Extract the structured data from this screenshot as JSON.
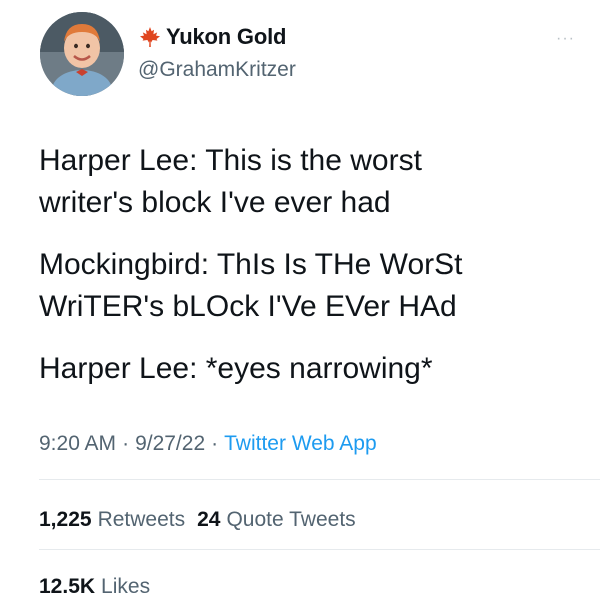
{
  "user": {
    "display_name": "Yukon Gold",
    "handle": "@GrahamKritzer",
    "badge_icon": "maple-leaf-icon",
    "badge_color": "#e0461f"
  },
  "more_icon": "···",
  "tweet": {
    "paragraphs": [
      "Harper Lee: This is the worst\nwriter's block I've ever had",
      "Mockingbird: ThIs Is THe WorSt\nWriTER's bLOck I'Ve EVer HAd",
      "Harper Lee: *eyes narrowing*"
    ]
  },
  "meta": {
    "time": "9:20 AM",
    "separator": "·",
    "date": "9/27/22",
    "source": "Twitter Web App"
  },
  "stats": {
    "retweets_count": "1,225",
    "retweets_label": "Retweets",
    "quotes_count": "24",
    "quotes_label": "Quote Tweets",
    "likes_count": "12.5K",
    "likes_label": "Likes"
  },
  "colors": {
    "text": "#0f1419",
    "secondary": "#536471",
    "link": "#1d9bf0",
    "divider": "#e6eaed"
  }
}
